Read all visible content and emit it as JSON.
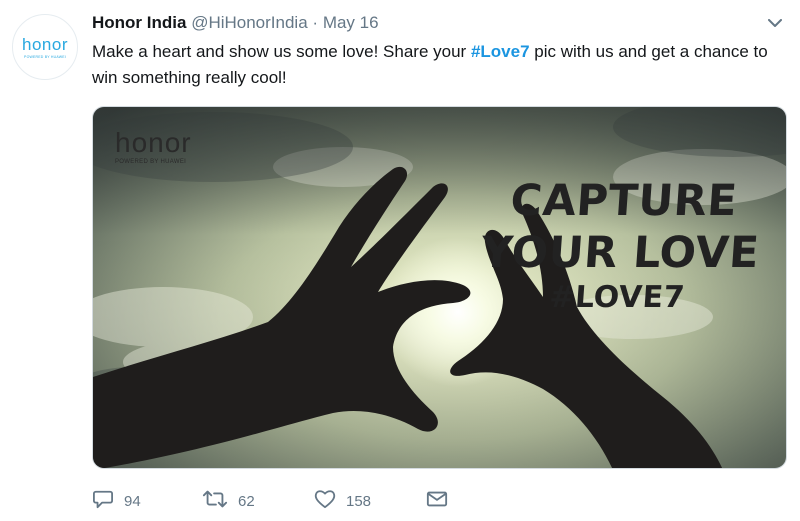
{
  "tweet": {
    "author_name": "Honor India",
    "handle": "@HiHonorIndia",
    "separator": "·",
    "date": "May 16",
    "text_before": "Make a heart and show us some love! Share your ",
    "hashtag": "#Love7",
    "text_after": " pic with us and get a chance to win something really cool!"
  },
  "avatar": {
    "logo_text": "honor",
    "sub_text": "POWERED BY HUAWEI"
  },
  "media": {
    "brand_logo": "honor",
    "brand_sub": "POWERED BY HUAWEI",
    "caption_line1": "CAPTURE",
    "caption_line2": "YOUR LOVE",
    "caption_tag": "#LOVE7"
  },
  "actions": {
    "reply_count": "94",
    "retweet_count": "62",
    "like_count": "158"
  },
  "icons": {
    "reply": "reply-icon",
    "retweet": "retweet-icon",
    "like": "heart-icon",
    "message": "envelope-icon",
    "menu": "chevron-down-icon"
  },
  "colors": {
    "hashtag": "#1b95e0",
    "secondary_text": "#657786",
    "brand": "#29a9e0"
  }
}
